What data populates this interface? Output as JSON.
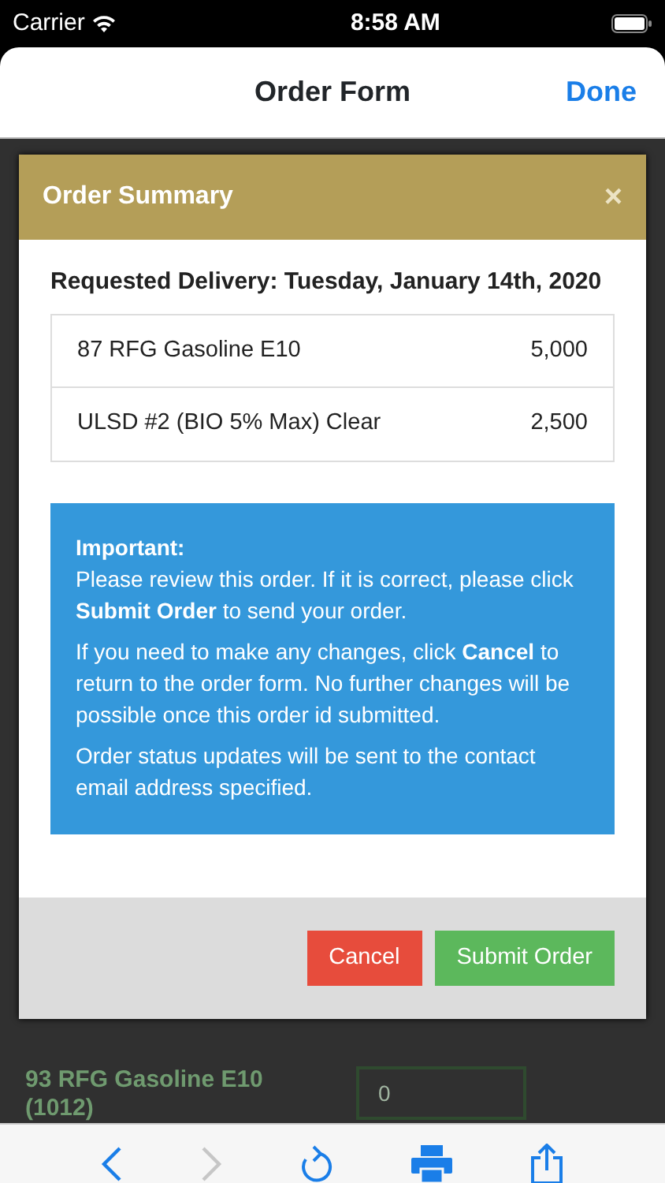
{
  "status_bar": {
    "carrier": "Carrier",
    "time": "8:58 AM"
  },
  "nav": {
    "title": "Order Form",
    "done": "Done"
  },
  "modal": {
    "title": "Order Summary",
    "close": "×",
    "delivery": "Requested Delivery: Tuesday, January 14th, 2020",
    "items": [
      {
        "product": "87 RFG Gasoline E10",
        "quantity": "5,000"
      },
      {
        "product": "ULSD #2 (BIO 5% Max) Clear",
        "quantity": "2,500"
      }
    ],
    "notice": {
      "heading": "Important:",
      "paragraphs": [
        "Please review this order. If it is correct, please click **Submit Order** to send your order.",
        "If you need to make any changes, click **Cancel** to return to the order form. No further changes will be possible once this order id submitted.",
        "Order status updates will be sent to the contact email address specified."
      ]
    },
    "buttons": [
      {
        "label": "Cancel",
        "kind": "danger"
      },
      {
        "label": "Submit Order",
        "kind": "success"
      }
    ]
  },
  "background_form": {
    "fields": [
      {
        "label": "93 RFG Gasoline E10 (1012)",
        "value": "0"
      }
    ]
  },
  "toolbar": [
    {
      "kind": "back",
      "disabled": false
    },
    {
      "kind": "forward",
      "disabled": true
    },
    {
      "kind": "reload",
      "disabled": false
    },
    {
      "kind": "print",
      "disabled": false
    },
    {
      "kind": "share",
      "disabled": false
    }
  ]
}
